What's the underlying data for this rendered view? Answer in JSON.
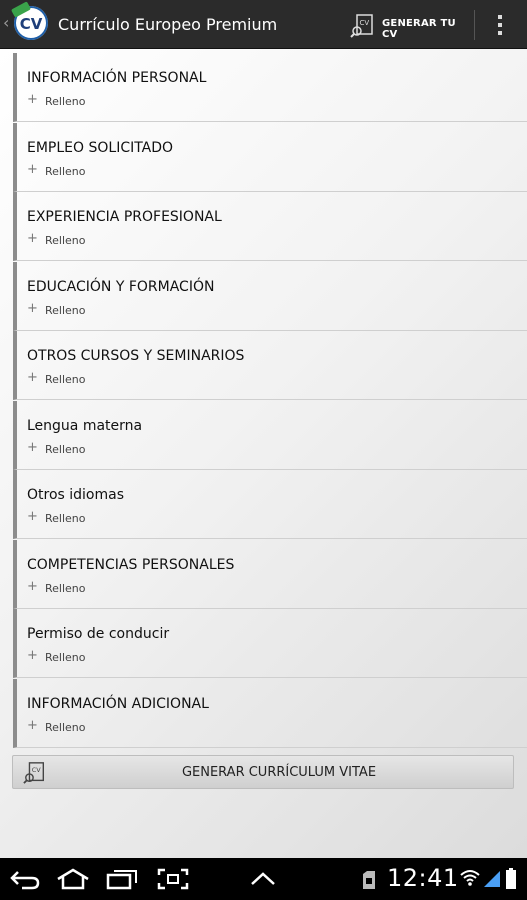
{
  "app": {
    "title": "Currículo Europeo Premium",
    "icon_text": "CV"
  },
  "toolbar": {
    "generate_label": "GENERAR TU CV"
  },
  "sections": [
    {
      "title": "INFORMACIÓN PERSONAL",
      "status": "Relleno"
    },
    {
      "title": "EMPLEO SOLICITADO",
      "status": "Relleno"
    },
    {
      "title": "EXPERIENCIA PROFESIONAL",
      "status": "Relleno"
    },
    {
      "title": "EDUCACIÓN Y FORMACIÓN",
      "status": "Relleno"
    },
    {
      "title": "OTROS CURSOS Y SEMINARIOS",
      "status": "Relleno"
    },
    {
      "title": "Lengua materna",
      "status": "Relleno"
    },
    {
      "title": "Otros idiomas",
      "status": "Relleno"
    },
    {
      "title": "COMPETENCIAS PERSONALES",
      "status": "Relleno"
    },
    {
      "title": "Permiso de conducir",
      "status": "Relleno"
    },
    {
      "title": "INFORMACIÓN ADICIONAL",
      "status": "Relleno"
    }
  ],
  "footer_button": {
    "label": "GENERAR CURRÍCULUM VITAE"
  },
  "statusbar": {
    "time": "12:41"
  },
  "colors": {
    "actionbar": "#2b2b2b",
    "section_bar": "#8c8c8c",
    "systembar": "#000000"
  }
}
